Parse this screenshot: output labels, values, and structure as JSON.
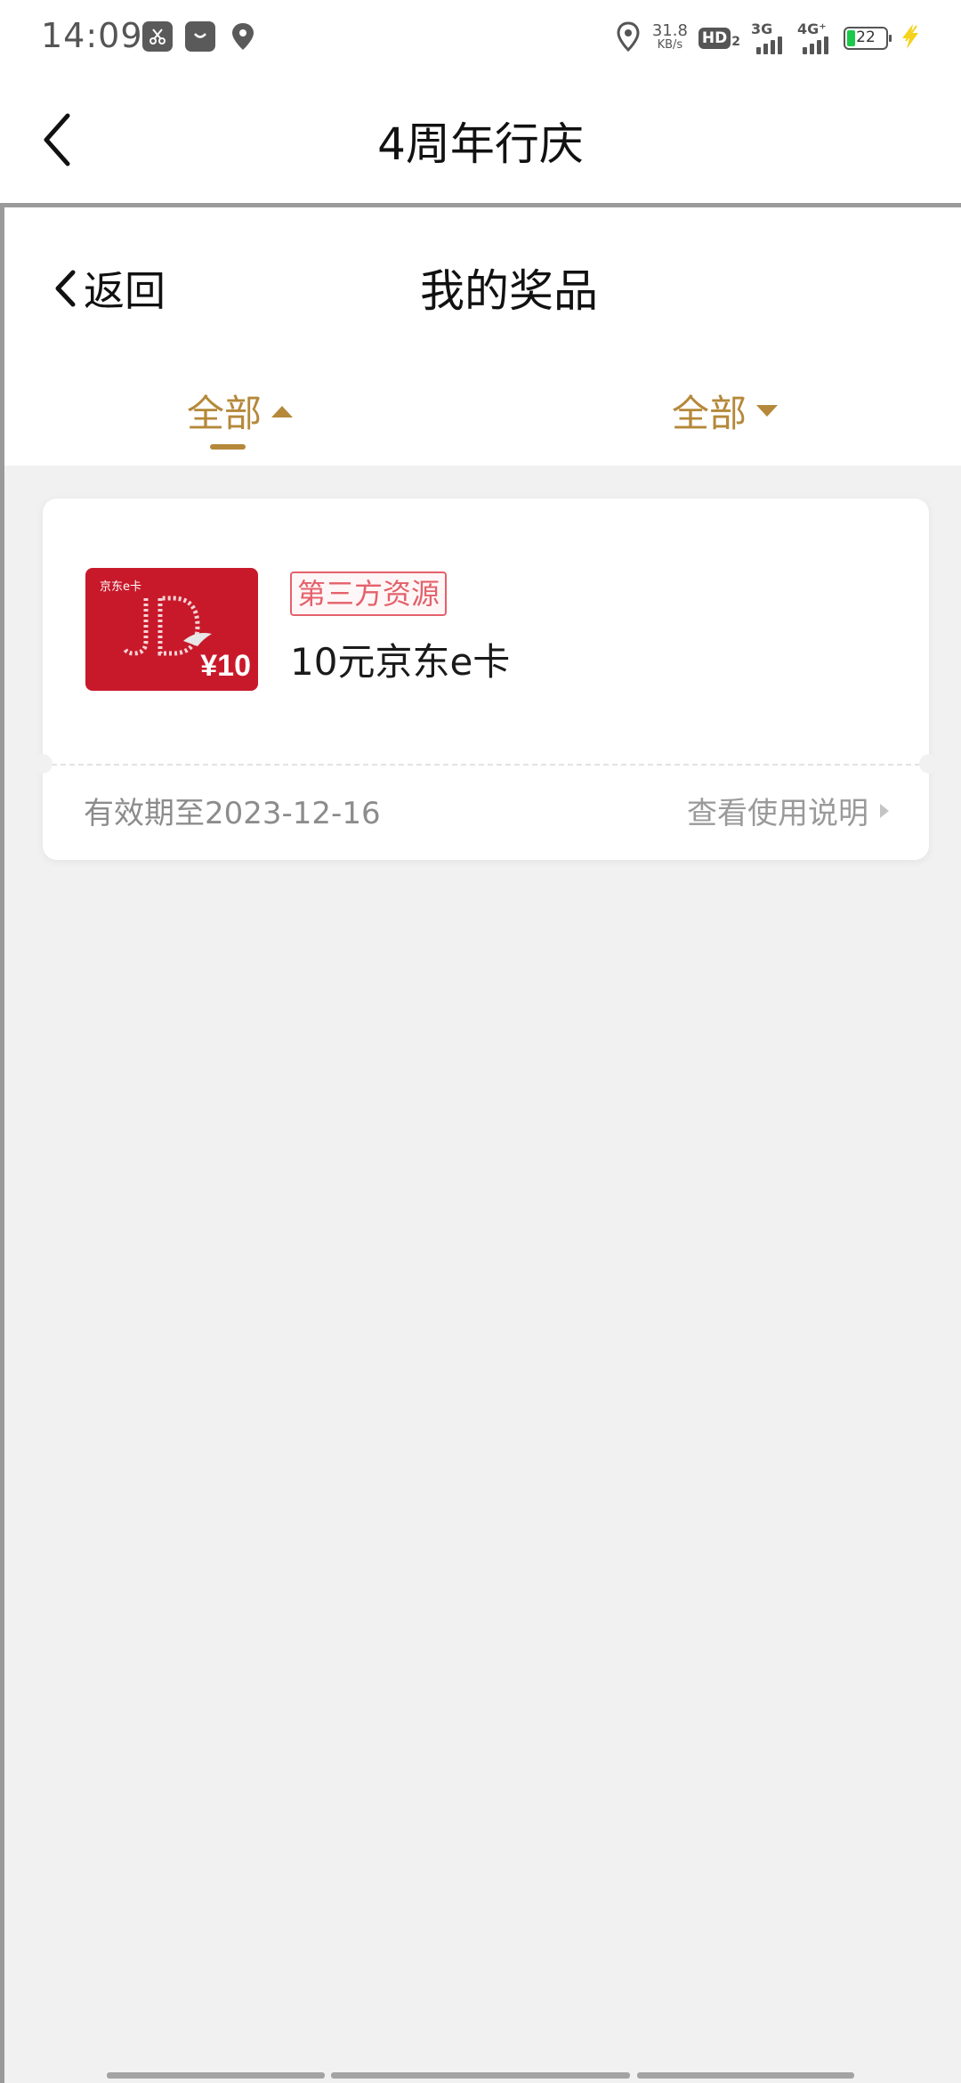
{
  "status_bar": {
    "time": "14:09",
    "net_speed_value": "31.8",
    "net_speed_unit": "KB/s",
    "hd_label": "HD",
    "hd_sub": "2",
    "sim1_type": "3G",
    "sim2_type": "4G⁺",
    "battery_level": "22",
    "battery_percent": 22
  },
  "app_header": {
    "title": "4周年行庆"
  },
  "page_header": {
    "back_label": "返回",
    "title": "我的奖品"
  },
  "filters": {
    "left": {
      "label": "全部",
      "arrow": "up",
      "active": true
    },
    "right": {
      "label": "全部",
      "arrow": "down",
      "active": false
    }
  },
  "prizes": [
    {
      "image_brand": "京东e卡",
      "image_price": "¥10",
      "source_badge": "第三方资源",
      "name": "10元京东e卡",
      "expiry": "有效期至2023-12-16",
      "instructions_label": "查看使用说明"
    }
  ],
  "colors": {
    "accent_gold": "#b5883a",
    "badge_red": "#e4616b",
    "card_red": "#c8192a",
    "page_bg": "#f2f1f2"
  }
}
